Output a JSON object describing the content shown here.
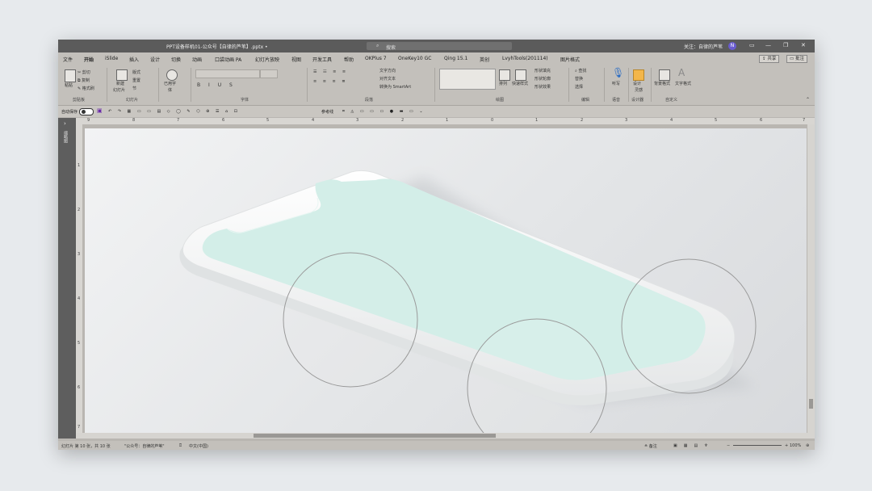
{
  "title_bar": {
    "document_title": "PPT设备样机01-公众号【自律的芦苇】.pptx  •",
    "search_placeholder": "搜索",
    "follow_text": "关注：自律的芦苇",
    "avatar_initials": "N",
    "controls": [
      "▭",
      "—",
      "❐",
      "✕"
    ]
  },
  "tabs": [
    "文件",
    "开始",
    "iSlide",
    "插入",
    "设计",
    "切换",
    "动画",
    "口袋动画 PA",
    "幻灯片放映",
    "视图",
    "开发工具",
    "帮助",
    "OKPlus 7",
    "OneKey10 GC",
    "Qing 15.1",
    "英创",
    "LvyhTools(201114)",
    "图片格式"
  ],
  "active_tab": "开始",
  "share_label": "共享",
  "comment_label": "批注",
  "ribbon": {
    "clipboard": {
      "paste": "粘贴",
      "cut": "剪切",
      "copy": "复制",
      "format_painter": "格式刷",
      "group": "剪贴板"
    },
    "slides": {
      "new_slide": "新建",
      "new_slide_sub": "幻灯片",
      "layout": "版式",
      "reset": "重置",
      "section": "节",
      "group": "幻灯片"
    },
    "font": {
      "used_fonts": "已用字",
      "used_fonts_sub": "体",
      "group": "字体"
    },
    "paragraph": {
      "text_direction": "文字方向",
      "align_text": "对齐文本",
      "smartart": "转换为 SmartArt",
      "group": "段落"
    },
    "drawing": {
      "arrange": "排列",
      "quick_styles": "快速样式",
      "fill": "形状填充",
      "outline": "形状轮廓",
      "effects": "形状效果",
      "group": "绘图"
    },
    "editing": {
      "find": "查找",
      "replace": "替换",
      "select": "选择",
      "group": "编辑"
    },
    "voice": {
      "dictate": "听写",
      "group": "语音"
    },
    "designer": {
      "design_ideas": "设计",
      "design_ideas_sub": "灵感",
      "group": "设计器"
    },
    "custom": {
      "background": "背景格式",
      "text_format": "文字格式",
      "group": "自定义"
    }
  },
  "quick_access": {
    "autosave": "自动保存",
    "reference_line": "参考线"
  },
  "ruler_h": [
    "9",
    "8",
    "7",
    "6",
    "5",
    "4",
    "3",
    "2",
    "1",
    "0",
    "1",
    "2",
    "3",
    "4",
    "5",
    "6",
    "7"
  ],
  "ruler_v": [
    "1",
    "2",
    "3",
    "4",
    "5",
    "6",
    "7"
  ],
  "left_pane_label": "缩略图",
  "status_bar": {
    "slide_info": "幻灯片 第 10 张，共 10 张",
    "theme": "\"公众号：自律的芦苇\"",
    "language": "中文(中国)",
    "notes": "备注",
    "zoom": "100%"
  },
  "colors": {
    "titlebar": "#5b5b5b",
    "ribbon": "#c3c0bb",
    "screen_mint": "#d3eee8",
    "phone_body": "#f7f8f8",
    "lens_stroke": "#9a9a9a"
  }
}
